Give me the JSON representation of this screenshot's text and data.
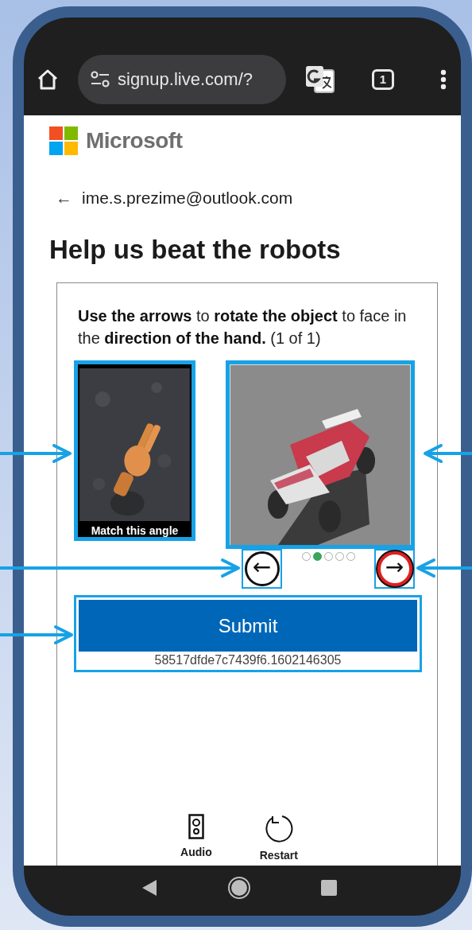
{
  "browser": {
    "url": "signup.live.com/?",
    "tab_count": "1"
  },
  "header": {
    "brand": "Microsoft"
  },
  "account": {
    "back": "←",
    "email": "ime.s.prezime@outlook.com"
  },
  "title": "Help us beat the robots",
  "captcha": {
    "instruction": "**Use the arrows** to **rotate the object** to face in the **direction of the hand.** (1 of 1)",
    "reference_caption": "Match this angle",
    "dots": [
      {
        "selected": false
      },
      {
        "selected": true
      },
      {
        "selected": false
      },
      {
        "selected": false
      },
      {
        "selected": false
      }
    ],
    "buttons": [
      {
        "kind": "left",
        "glyph": "←",
        "focused": false
      },
      {
        "kind": "right",
        "glyph": "→",
        "focused": true
      }
    ],
    "submit": "Submit",
    "session_id": "58517dfde7c7439f6.1602146305",
    "tools": [
      {
        "kind": "audio",
        "label": "Audio"
      },
      {
        "kind": "restart",
        "label": "Restart"
      }
    ]
  }
}
